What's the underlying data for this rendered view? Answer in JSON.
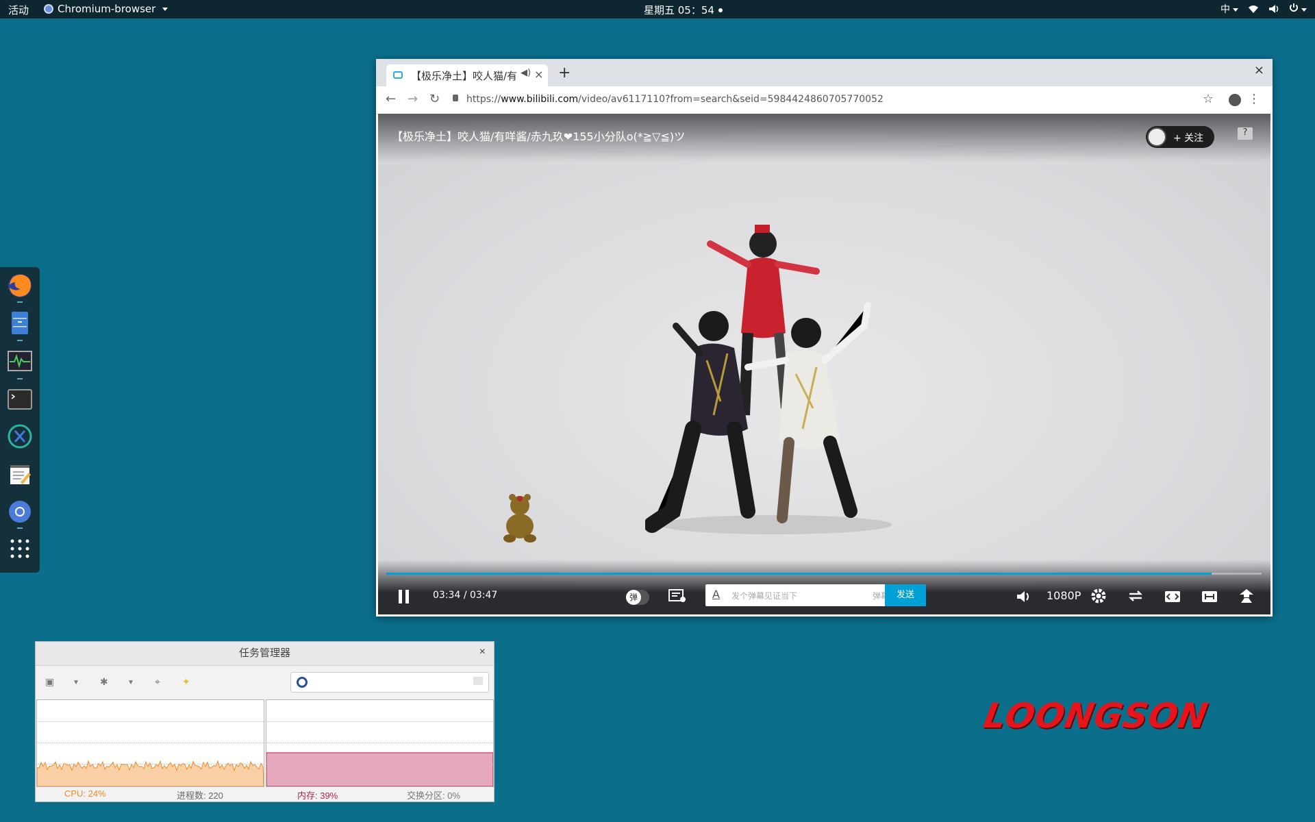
{
  "topbar": {
    "activities": "活动",
    "app_menu": "Chromium-browser",
    "clock": "星期五 05：54",
    "input_method": "中"
  },
  "dock": {
    "items": [
      "firefox-icon",
      "file-manager-icon",
      "system-monitor-icon",
      "terminal-icon",
      "remote-icon",
      "text-editor-icon",
      "chromium-icon",
      "app-grid-icon"
    ]
  },
  "browser": {
    "tab_title": "【极乐净土】咬人猫/有",
    "url_scheme": "https://",
    "url_host": "www.bilibili.com",
    "url_path": "/video/av6117110?from=search&seid=5984424860705770052"
  },
  "player": {
    "title": "【极乐净土】咬人猫/有咩酱/赤九玖❤155小分队o(*≧▽≦)ツ",
    "follow_label": "+ 关注",
    "help": "?",
    "time_current": "03:34",
    "time_sep": "/",
    "time_total": "03:47",
    "progress": 0.943,
    "danmaku_toggle": "弹",
    "danmaku_placeholder": "发个弹幕见证当下",
    "danmaku_etiquette": "弹幕礼仪 ›",
    "send_label": "发送",
    "quality": "1080P",
    "accent": "#00a1d6"
  },
  "task_manager": {
    "title": "任务管理器",
    "cpu_label": "CPU: 24%",
    "processes_label": "进程数: 220",
    "memory_label": "内存: 39%",
    "swap_label": "交换分区: 0%",
    "cpu_percent": 24,
    "memory_percent": 39,
    "cpu_color": "#f08a24",
    "memory_color": "#b5224a"
  },
  "wallpaper": {
    "logo": "LOONGSON"
  }
}
